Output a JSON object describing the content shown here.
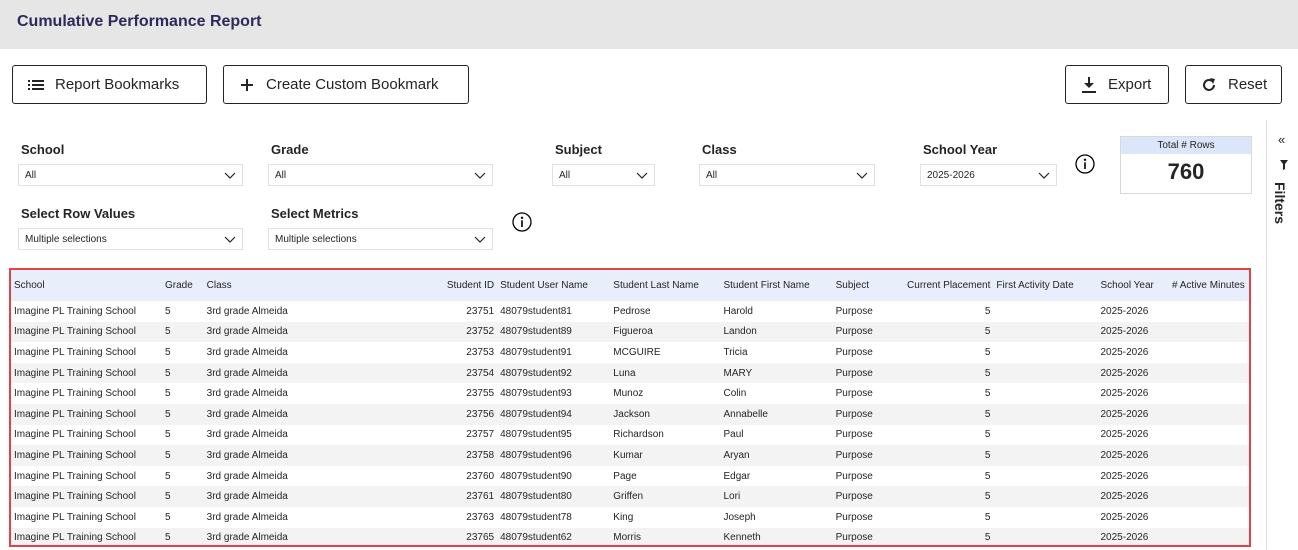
{
  "header": {
    "title": "Cumulative Performance Report"
  },
  "toolbar": {
    "bookmarks_label": "Report Bookmarks",
    "custom_label": "Create Custom Bookmark",
    "export_label": "Export",
    "reset_label": "Reset"
  },
  "filters": {
    "school": {
      "label": "School",
      "value": "All"
    },
    "grade": {
      "label": "Grade",
      "value": "All"
    },
    "subject": {
      "label": "Subject",
      "value": "All"
    },
    "class": {
      "label": "Class",
      "value": "All"
    },
    "school_year": {
      "label": "School Year",
      "value": "2025-2026"
    },
    "row_values": {
      "label": "Select Row Values",
      "value": "Multiple selections"
    },
    "metrics": {
      "label": "Select Metrics",
      "value": "Multiple selections"
    }
  },
  "kpi": {
    "label": "Total # Rows",
    "value": "760"
  },
  "filters_pane": {
    "label": "Filters"
  },
  "table": {
    "columns": [
      "School",
      "Grade",
      "Class",
      "Student ID",
      "Student User Name",
      "Student Last Name",
      "Student First Name",
      "Subject",
      "Current Placement",
      "First Activity Date",
      "School Year",
      "# Active Minutes"
    ],
    "rows": [
      [
        "Imagine PL Training School",
        "5",
        "3rd grade Almeida",
        "23751",
        "48079student81",
        "Pedrose",
        "Harold",
        "Purpose",
        "5",
        "",
        "2025-2026",
        ""
      ],
      [
        "Imagine PL Training School",
        "5",
        "3rd grade Almeida",
        "23752",
        "48079student89",
        "Figueroa",
        "Landon",
        "Purpose",
        "5",
        "",
        "2025-2026",
        ""
      ],
      [
        "Imagine PL Training School",
        "5",
        "3rd grade Almeida",
        "23753",
        "48079student91",
        "MCGUIRE",
        "Tricia",
        "Purpose",
        "5",
        "",
        "2025-2026",
        ""
      ],
      [
        "Imagine PL Training School",
        "5",
        "3rd grade Almeida",
        "23754",
        "48079student92",
        "Luna",
        "MARY",
        "Purpose",
        "5",
        "",
        "2025-2026",
        ""
      ],
      [
        "Imagine PL Training School",
        "5",
        "3rd grade Almeida",
        "23755",
        "48079student93",
        "Munoz",
        "Colin",
        "Purpose",
        "5",
        "",
        "2025-2026",
        ""
      ],
      [
        "Imagine PL Training School",
        "5",
        "3rd grade Almeida",
        "23756",
        "48079student94",
        "Jackson",
        "Annabelle",
        "Purpose",
        "5",
        "",
        "2025-2026",
        ""
      ],
      [
        "Imagine PL Training School",
        "5",
        "3rd grade Almeida",
        "23757",
        "48079student95",
        "Richardson",
        "Paul",
        "Purpose",
        "5",
        "",
        "2025-2026",
        ""
      ],
      [
        "Imagine PL Training School",
        "5",
        "3rd grade Almeida",
        "23758",
        "48079student96",
        "Kumar",
        "Aryan",
        "Purpose",
        "5",
        "",
        "2025-2026",
        ""
      ],
      [
        "Imagine PL Training School",
        "5",
        "3rd grade Almeida",
        "23760",
        "48079student90",
        "Page",
        "Edgar",
        "Purpose",
        "5",
        "",
        "2025-2026",
        ""
      ],
      [
        "Imagine PL Training School",
        "5",
        "3rd grade Almeida",
        "23761",
        "48079student80",
        "Griffen",
        "Lori",
        "Purpose",
        "5",
        "",
        "2025-2026",
        ""
      ],
      [
        "Imagine PL Training School",
        "5",
        "3rd grade Almeida",
        "23763",
        "48079student78",
        "King",
        "Joseph",
        "Purpose",
        "5",
        "",
        "2025-2026",
        ""
      ],
      [
        "Imagine PL Training School",
        "5",
        "3rd grade Almeida",
        "23765",
        "48079student62",
        "Morris",
        "Kenneth",
        "Purpose",
        "5",
        "",
        "2025-2026",
        ""
      ]
    ]
  }
}
